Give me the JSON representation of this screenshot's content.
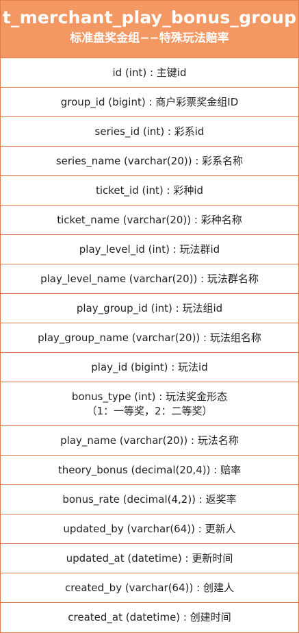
{
  "table": {
    "title": "t_merchant_play_bonus_group",
    "subtitle": "标准盘奖金组−−特殊玩法赔率",
    "colors": {
      "header_bg": "#f39763",
      "border": "#e07b4a",
      "header_text": "#ffffff",
      "row_text": "#222222"
    },
    "fields": [
      "id (int) : 主键id",
      "group_id (bigint) : 商户彩票奖金组ID",
      "series_id (int) : 彩系id",
      "series_name (varchar(20)) : 彩系名称",
      "ticket_id (int) : 彩种id",
      "ticket_name (varchar(20)) : 彩种名称",
      "play_level_id (int) : 玩法群id",
      "play_level_name (varchar(20)) : 玩法群名称",
      "play_group_id (int) : 玩法组id",
      "play_group_name (varchar(20)) : 玩法组名称",
      "play_id (bigint) : 玩法id",
      "bonus_type (int) : 玩法奖金形态\n（1：一等奖，2：二等奖）",
      "play_name (varchar(20)) : 玩法名称",
      "theory_bonus (decimal(20,4)) : 赔率",
      "bonus_rate (decimal(4,2)) : 返奖率",
      "updated_by (varchar(64)) : 更新人",
      "updated_at (datetime) : 更新时间",
      "created_by (varchar(64)) : 创建人",
      "created_at (datetime) : 创建时间"
    ]
  }
}
